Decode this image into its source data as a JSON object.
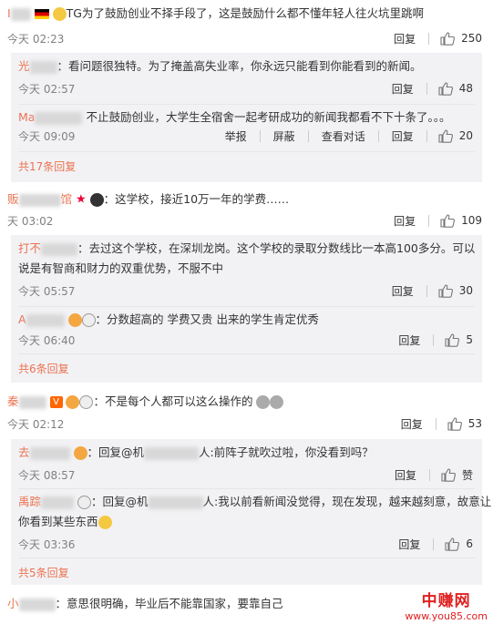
{
  "actions": {
    "reply": "回复",
    "report": "举报",
    "block": "屏蔽",
    "view_dialog": "查看对话"
  },
  "c1": {
    "name": "Ⅰ",
    "text": "TG为了鼓励创业不择手段了，这是鼓励什么都不懂年轻人往火坑里跳啊",
    "time": "今天 02:23",
    "likes": "250"
  },
  "c1r1": {
    "name": "光",
    "text": "：看问题很独特。为了掩盖高失业率，你永远只能看到你能看到的新闻。",
    "time": "今天 02:57",
    "likes": "48"
  },
  "c1r2": {
    "name": "Ma",
    "text": "不止鼓励创业，大学生全宿舍一起考研成功的新闻我都看不下十条了。。。",
    "time": "今天 09:09",
    "likes": "20"
  },
  "c1_more": "共17条回复",
  "c2": {
    "name": "贩",
    "name2": "馆",
    "text": "：这学校，接近10万一年的学费……",
    "time": "天 03:02",
    "likes": "109"
  },
  "c2r1": {
    "name": "打不",
    "text": "：去过这个学校，在深圳龙岗。这个学校的录取分数线比一本高100多分。可以",
    "text2": "说是有智商和财力的双重优势，不服不中",
    "time": "今天 05:57",
    "likes": "30"
  },
  "c2r2": {
    "name": "A",
    "text": "：分数超高的 学费又贵 出来的学生肯定优秀",
    "time": "今天 06:40",
    "likes": "5"
  },
  "c2_more": "共6条回复",
  "c3": {
    "name": "秦",
    "text": "：不是每个人都可以这么操作的",
    "time": "今天 02:12",
    "likes": "53"
  },
  "c3r1": {
    "name": "去",
    "text": "：回复@机",
    "text_b": "人:前阵子就吹过啦，你没看到吗？",
    "time": "今天 08:57",
    "likes": "赞"
  },
  "c3r2": {
    "name": "禹踪",
    "text": "：回复@机",
    "text_b": "人:我以前看新闻没觉得，现在发现，越来越刻意，故意让",
    "text2": "你看到某些东西",
    "time": "今天 03:36",
    "likes": "6"
  },
  "c3_more": "共5条回复",
  "c4": {
    "name": "小",
    "text": "：意思很明确，毕业后不能靠国家，要靠自己"
  },
  "watermark": {
    "big": "中赚网",
    "small": "www.you85.com"
  }
}
